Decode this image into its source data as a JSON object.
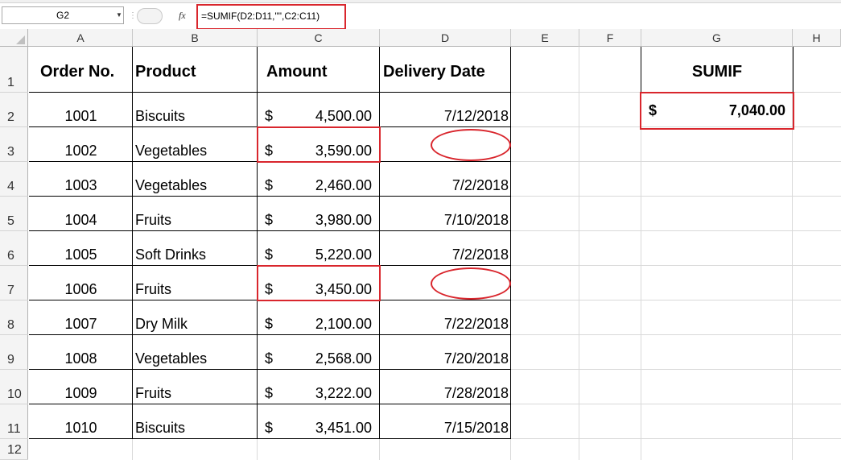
{
  "formula_bar": {
    "name_box": "G2",
    "fx_label": "fx",
    "formula": "=SUMIF(D2:D11,\"\",C2:C11)"
  },
  "columns": [
    "A",
    "B",
    "C",
    "D",
    "E",
    "F",
    "G",
    "H"
  ],
  "rows": [
    "1",
    "2",
    "3",
    "4",
    "5",
    "6",
    "7",
    "8",
    "9",
    "10",
    "11",
    "12"
  ],
  "table": {
    "headers": [
      "Order No.",
      "Product",
      "Amount",
      "Delivery Date"
    ],
    "currency_symbol": "$",
    "rows": [
      {
        "order": "1001",
        "product": "Biscuits",
        "amount": "4,500.00",
        "date": "7/12/2018"
      },
      {
        "order": "1002",
        "product": "Vegetables",
        "amount": "3,590.00",
        "date": ""
      },
      {
        "order": "1003",
        "product": "Vegetables",
        "amount": "2,460.00",
        "date": "7/2/2018"
      },
      {
        "order": "1004",
        "product": "Fruits",
        "amount": "3,980.00",
        "date": "7/10/2018"
      },
      {
        "order": "1005",
        "product": "Soft Drinks",
        "amount": "5,220.00",
        "date": "7/2/2018"
      },
      {
        "order": "1006",
        "product": "Fruits",
        "amount": "3,450.00",
        "date": ""
      },
      {
        "order": "1007",
        "product": "Dry Milk",
        "amount": "2,100.00",
        "date": "7/22/2018"
      },
      {
        "order": "1008",
        "product": "Vegetables",
        "amount": "2,568.00",
        "date": "7/20/2018"
      },
      {
        "order": "1009",
        "product": "Fruits",
        "amount": "3,222.00",
        "date": "7/28/2018"
      },
      {
        "order": "1010",
        "product": "Biscuits",
        "amount": "3,451.00",
        "date": "7/15/2018"
      }
    ]
  },
  "result": {
    "header": "SUMIF",
    "currency_symbol": "$",
    "value": "7,040.00"
  },
  "colors": {
    "highlight": "#d9262d",
    "header_bg": "#f4f4f4",
    "gridline": "#d9d9d9"
  }
}
